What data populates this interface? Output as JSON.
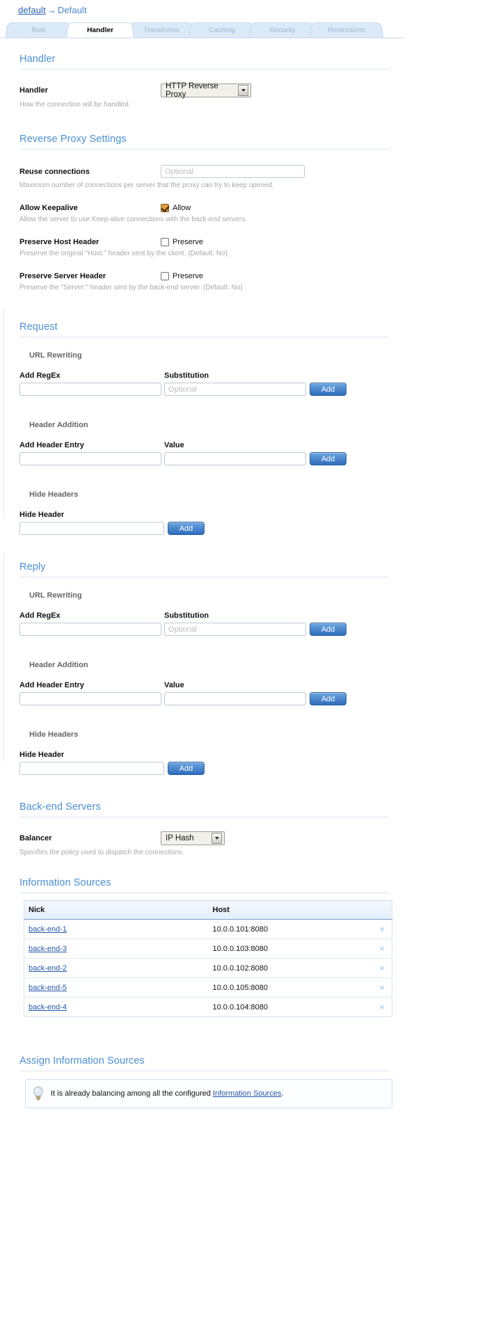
{
  "breadcrumb": {
    "root": "default",
    "separator": "→",
    "current": "Default"
  },
  "tabs": [
    {
      "label": "Rule",
      "active": false
    },
    {
      "label": "Handler",
      "active": true
    },
    {
      "label": "Transforms",
      "active": false
    },
    {
      "label": "Caching",
      "active": false
    },
    {
      "label": "Security",
      "active": false
    },
    {
      "label": "Restrictions",
      "active": false
    }
  ],
  "handler_section": {
    "title": "Handler",
    "field_label": "Handler",
    "value": "HTTP Reverse Proxy",
    "help": "How the connection will be handled."
  },
  "reverse_proxy": {
    "title": "Reverse Proxy Settings",
    "reuse": {
      "label": "Reuse connections",
      "placeholder": "Optional",
      "value": "",
      "help": "Maximum number of connections per server that the proxy can try to keep opened."
    },
    "keepalive": {
      "label": "Allow Keepalive",
      "checkbox_label": "Allow",
      "checked": true,
      "help": "Allow the server to use Keep-alive connections with the back-end servers."
    },
    "preserve_host": {
      "label": "Preserve Host Header",
      "checkbox_label": "Preserve",
      "checked": false,
      "help": "Preserve the original \"Host:\" header sent by the client. (Default: No)"
    },
    "preserve_server": {
      "label": "Preserve Server Header",
      "checkbox_label": "Preserve",
      "checked": false,
      "help": "Preserve the \"Server:\" header sent by the back-end server. (Default: No)"
    }
  },
  "request": {
    "title": "Request",
    "url_rewriting": {
      "subhead": "URL Rewriting",
      "regex_label": "Add RegEx",
      "regex_value": "",
      "substitution_label": "Substitution",
      "substitution_placeholder": "Optional",
      "substitution_value": "",
      "add_label": "Add"
    },
    "header_addition": {
      "subhead": "Header Addition",
      "entry_label": "Add Header Entry",
      "entry_value": "",
      "value_label": "Value",
      "value_value": "",
      "add_label": "Add"
    },
    "hide_headers": {
      "subhead": "Hide Headers",
      "hide_label": "Hide Header",
      "hide_value": "",
      "add_label": "Add"
    }
  },
  "reply": {
    "title": "Reply",
    "url_rewriting": {
      "subhead": "URL Rewriting",
      "regex_label": "Add RegEx",
      "regex_value": "",
      "substitution_label": "Substitution",
      "substitution_placeholder": "Optional",
      "substitution_value": "",
      "add_label": "Add"
    },
    "header_addition": {
      "subhead": "Header Addition",
      "entry_label": "Add Header Entry",
      "entry_value": "",
      "value_label": "Value",
      "value_value": "",
      "add_label": "Add"
    },
    "hide_headers": {
      "subhead": "Hide Headers",
      "hide_label": "Hide Header",
      "hide_value": "",
      "add_label": "Add"
    }
  },
  "backend": {
    "title": "Back-end Servers",
    "balancer_label": "Balancer",
    "balancer_value": "IP Hash",
    "help": "Specifies the policy used to dispatch the connections."
  },
  "information_sources": {
    "title": "Information Sources",
    "columns": [
      "Nick",
      "Host"
    ],
    "rows": [
      {
        "nick": "back-end-1",
        "host": "10.0.0.101:8080",
        "delete": "×"
      },
      {
        "nick": "back-end-3",
        "host": "10.0.0.103:8080",
        "delete": "×"
      },
      {
        "nick": "back-end-2",
        "host": "10.0.0.102:8080",
        "delete": "×"
      },
      {
        "nick": "back-end-5",
        "host": "10.0.0.105:8080",
        "delete": "×"
      },
      {
        "nick": "back-end-4",
        "host": "10.0.0.104:8080",
        "delete": "×"
      }
    ]
  },
  "assign": {
    "title": "Assign Information Sources",
    "notice_prefix": "It is already balancing among all the configured ",
    "notice_link": "Information Sources",
    "notice_suffix": "."
  },
  "colors": {
    "accent": "#4a8fd6",
    "link": "#2457a8",
    "button": "#2f6dbd",
    "checkbox_checked": "#e09c3a"
  }
}
